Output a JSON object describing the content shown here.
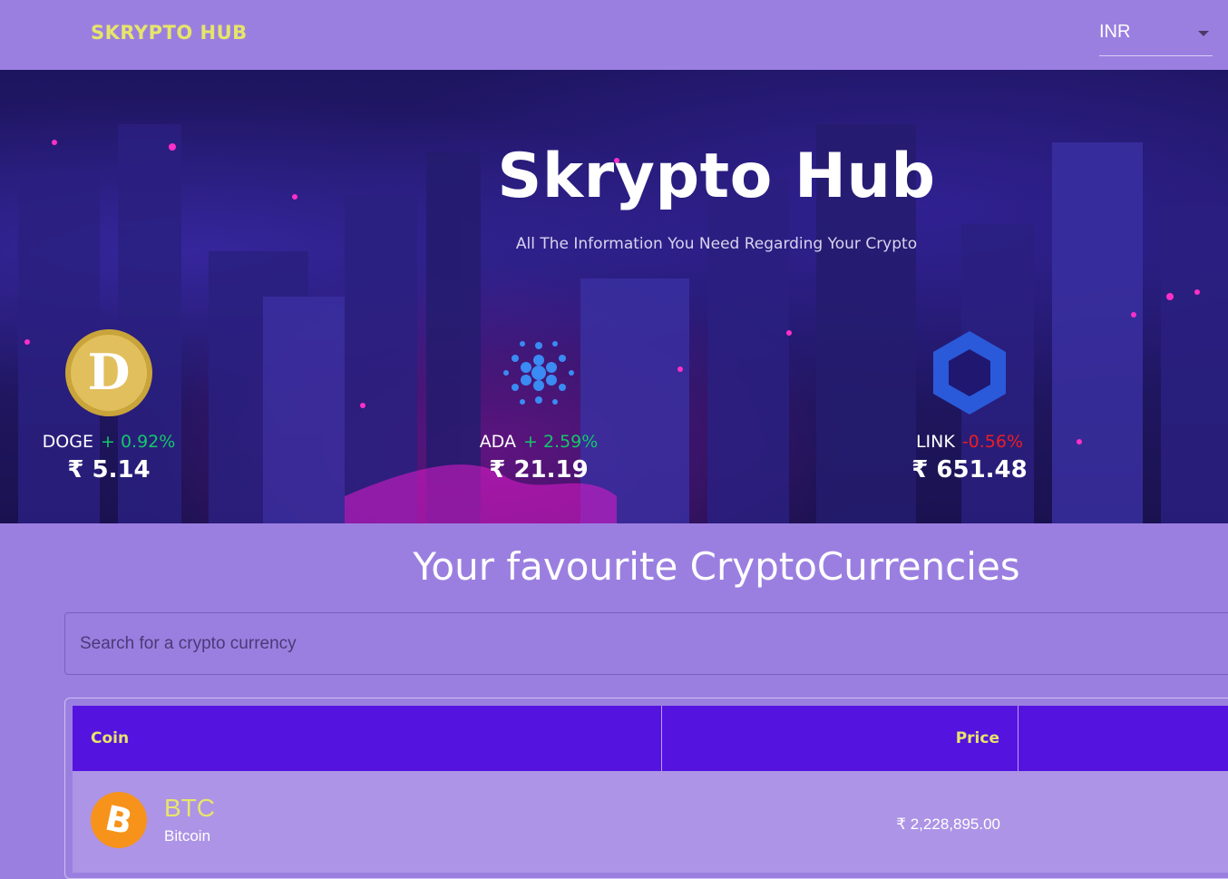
{
  "header": {
    "brand": "SKRYPTO HUB",
    "currency": {
      "selected": "INR"
    }
  },
  "hero": {
    "title": "Skrypto Hub",
    "subtitle": "All The Information You Need Regarding Your Crypto",
    "trending": [
      {
        "symbol": "DOGE",
        "change": "+ 0.92%",
        "direction": "up",
        "price": "₹ 5.14",
        "icon": "doge-icon"
      },
      {
        "symbol": "ADA",
        "change": "+ 2.59%",
        "direction": "up",
        "price": "₹ 21.19",
        "icon": "cardano-icon"
      },
      {
        "symbol": "LINK",
        "change": "-0.56%",
        "direction": "down",
        "price": "₹ 651.48",
        "icon": "chainlink-icon"
      }
    ]
  },
  "section": {
    "title": "Your favourite CryptoCurrencies"
  },
  "search": {
    "placeholder": "Search for a crypto currency",
    "value": ""
  },
  "table": {
    "columns": [
      "Coin",
      "Price",
      ""
    ],
    "rows": [
      {
        "symbol": "BTC",
        "name": "Bitcoin",
        "price": "₹ 2,228,895.00",
        "icon": "bitcoin-icon"
      }
    ]
  },
  "colors": {
    "background": "#9b7fe0",
    "brand_yellow": "#e6e56a",
    "table_header": "#5513e0",
    "positive": "#14c76a",
    "negative": "#ee1c22"
  }
}
